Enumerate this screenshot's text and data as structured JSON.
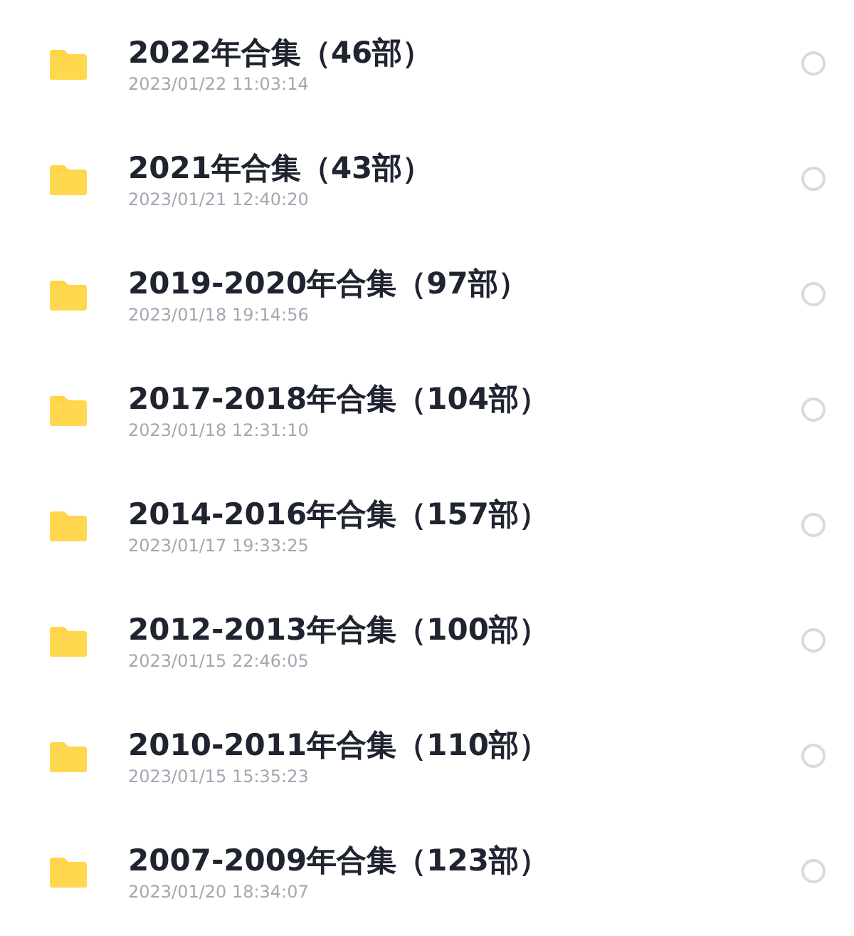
{
  "folders": [
    {
      "name": "2022年合集（46部）",
      "modified": "2023/01/22 11:03:14",
      "selected": false
    },
    {
      "name": "2021年合集（43部）",
      "modified": "2023/01/21 12:40:20",
      "selected": false
    },
    {
      "name": "2019-2020年合集（97部）",
      "modified": "2023/01/18 19:14:56",
      "selected": false
    },
    {
      "name": "2017-2018年合集（104部）",
      "modified": "2023/01/18 12:31:10",
      "selected": false
    },
    {
      "name": "2014-2016年合集（157部）",
      "modified": "2023/01/17 19:33:25",
      "selected": false
    },
    {
      "name": "2012-2013年合集（100部）",
      "modified": "2023/01/15 22:46:05",
      "selected": false
    },
    {
      "name": "2010-2011年合集（110部）",
      "modified": "2023/01/15 15:35:23",
      "selected": false
    },
    {
      "name": "2007-2009年合集（123部）",
      "modified": "2023/01/20 18:34:07",
      "selected": false
    }
  ]
}
